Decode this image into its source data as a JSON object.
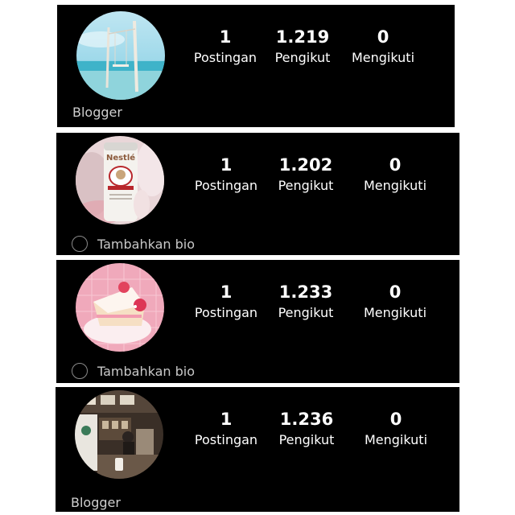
{
  "profiles": [
    {
      "stats": [
        {
          "num": "1",
          "label": "Postingan"
        },
        {
          "num": "1.219",
          "label": "Pengikut"
        },
        {
          "num": "0",
          "label": "Mengikuti"
        }
      ],
      "bio": "Blogger"
    },
    {
      "stats": [
        {
          "num": "1",
          "label": "Postingan"
        },
        {
          "num": "1.202",
          "label": "Pengikut"
        },
        {
          "num": "0",
          "label": "Mengikuti"
        }
      ],
      "add_bio": "Tambahkan bio"
    },
    {
      "stats": [
        {
          "num": "1",
          "label": "Postingan"
        },
        {
          "num": "1.233",
          "label": "Pengikut"
        },
        {
          "num": "0",
          "label": "Mengikuti"
        }
      ],
      "add_bio": "Tambahkan bio"
    },
    {
      "stats": [
        {
          "num": "1",
          "label": "Postingan"
        },
        {
          "num": "1.236",
          "label": "Pengikut"
        },
        {
          "num": "0",
          "label": "Mengikuti"
        }
      ],
      "bio": "Blogger"
    }
  ],
  "avatar_logo_text": "Nestlé"
}
